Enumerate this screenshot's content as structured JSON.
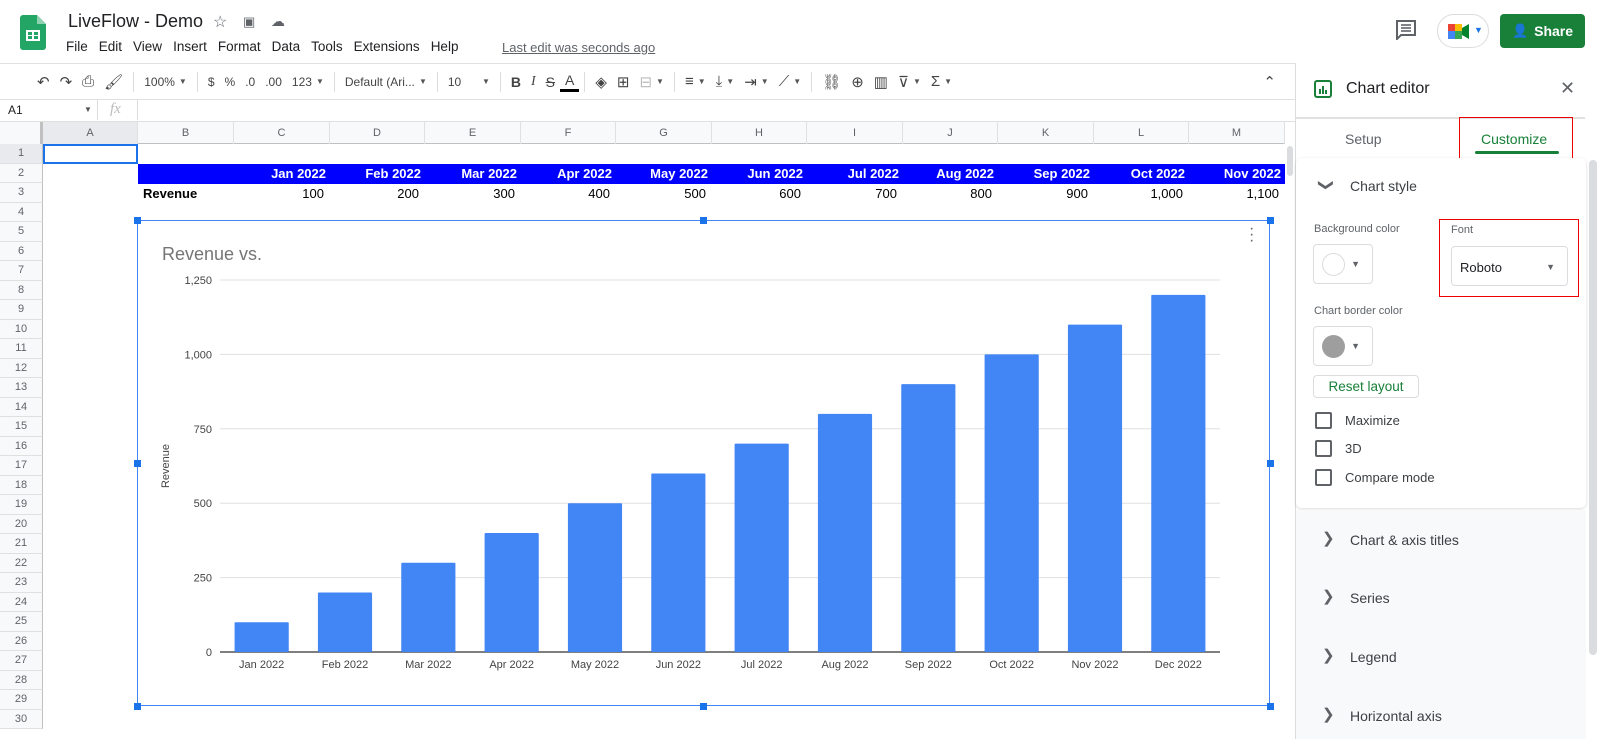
{
  "app": {
    "doc_title": "LiveFlow - Demo",
    "menu": [
      "File",
      "Edit",
      "View",
      "Insert",
      "Format",
      "Data",
      "Tools",
      "Extensions",
      "Help"
    ],
    "last_edit": "Last edit was seconds ago",
    "share_label": "Share"
  },
  "toolbar": {
    "zoom": "100%",
    "currency": "$",
    "percent": "%",
    "dec_decrease": ".0",
    "dec_increase": ".00",
    "more_formats": "123",
    "font": "Default (Ari...",
    "font_size": "10",
    "bold": "B",
    "italic": "I",
    "strike": "S",
    "text_color": "A"
  },
  "formula_bar": {
    "cell_ref": "A1",
    "fx": "fx",
    "value": ""
  },
  "grid": {
    "columns": [
      "A",
      "B",
      "C",
      "D",
      "E",
      "F",
      "G",
      "H",
      "I",
      "J",
      "K",
      "L",
      "M"
    ],
    "rows": [
      "1",
      "2",
      "3",
      "4",
      "5",
      "6",
      "7",
      "8",
      "9",
      "10",
      "11",
      "12",
      "13",
      "14",
      "15",
      "16",
      "17",
      "18",
      "19",
      "20",
      "21",
      "22",
      "23",
      "24",
      "25",
      "26",
      "27",
      "28",
      "29",
      "30"
    ],
    "header_row": [
      "Jan 2022",
      "Feb 2022",
      "Mar 2022",
      "Apr 2022",
      "May 2022",
      "Jun 2022",
      "Jul 2022",
      "Aug 2022",
      "Sep 2022",
      "Oct 2022",
      "Nov 2022"
    ],
    "revenue_label": "Revenue",
    "revenue_values": [
      "100",
      "200",
      "300",
      "400",
      "500",
      "600",
      "700",
      "800",
      "900",
      "1,000",
      "1,100"
    ],
    "header_color": "#0000ff"
  },
  "chart_data": {
    "type": "bar",
    "title": "Revenue vs.",
    "xlabel": "",
    "ylabel": "Revenue",
    "categories": [
      "Jan 2022",
      "Feb 2022",
      "Mar 2022",
      "Apr 2022",
      "May 2022",
      "Jun 2022",
      "Jul 2022",
      "Aug 2022",
      "Sep 2022",
      "Oct 2022",
      "Nov 2022",
      "Dec 2022"
    ],
    "values": [
      100,
      200,
      300,
      400,
      500,
      600,
      700,
      800,
      900,
      1000,
      1100,
      1200
    ],
    "yticks": [
      0,
      250,
      500,
      750,
      1000,
      1250
    ],
    "ytick_labels": [
      "0",
      "250",
      "500",
      "750",
      "1,000",
      "1,250"
    ],
    "ylim": [
      0,
      1250
    ],
    "grid": true,
    "legend": "none",
    "bar_color": "#4285f4"
  },
  "chart_editor": {
    "title": "Chart editor",
    "tabs": [
      "Setup",
      "Customize"
    ],
    "active_tab": "Customize",
    "section_open": "Chart style",
    "background_color_label": "Background color",
    "background_color": "#ffffff",
    "font_label": "Font",
    "font_value": "Roboto",
    "border_color_label": "Chart border color",
    "border_color": "#9e9e9e",
    "reset_layout": "Reset layout",
    "checkboxes": [
      {
        "label": "Maximize",
        "checked": false
      },
      {
        "label": "3D",
        "checked": false
      },
      {
        "label": "Compare mode",
        "checked": false
      }
    ],
    "collapsed_sections": [
      "Chart & axis titles",
      "Series",
      "Legend",
      "Horizontal axis"
    ],
    "accent": "#188038"
  }
}
